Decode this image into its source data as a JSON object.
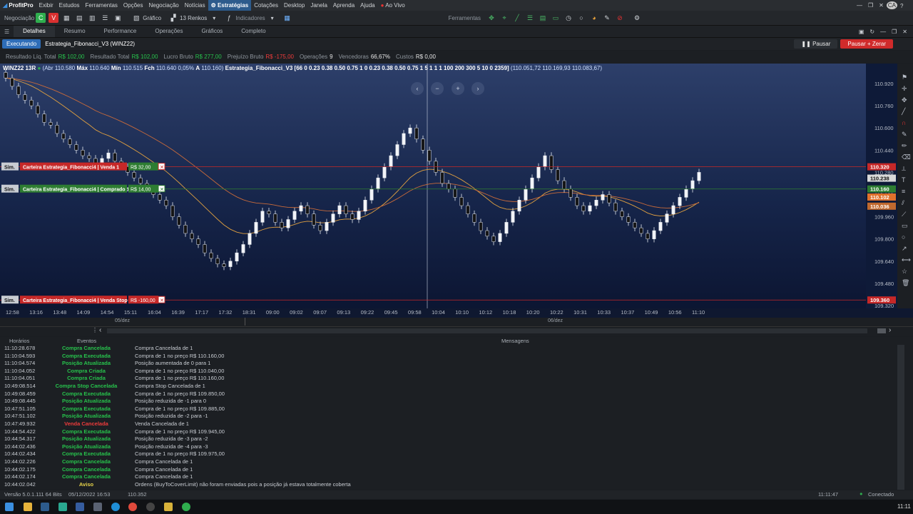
{
  "menubar": {
    "app_name": "ProfitPro",
    "items": [
      "Exibir",
      "Estudos",
      "Ferramentas",
      "Opções",
      "Negociação",
      "Notícias",
      "Estratégias",
      "Cotações",
      "Desktop",
      "Janela",
      "Aprenda",
      "Ajuda"
    ],
    "live_label": "Ao Vivo"
  },
  "toolbar": {
    "negociacao_label": "Negociação",
    "grafico_label": "Gráfico",
    "renkos_label": "13 Renkos",
    "indicadores_label": "Indicadores",
    "ferramentas_label": "Ferramentas"
  },
  "tabs": [
    "Detalhes",
    "Resumo",
    "Performance",
    "Operações",
    "Gráficos",
    "Completo"
  ],
  "strategy": {
    "status": "Executando",
    "name": "Estrategia_Fibonacci_V3 (WINZ22)",
    "pause_label": "Pausar",
    "pause_zero_label": "Pausar + Zerar"
  },
  "stats": [
    {
      "label": "Resultado Líq. Total",
      "value": "R$ 102,00",
      "color": "green"
    },
    {
      "label": "Resultado Total",
      "value": "R$ 102,00",
      "color": "green"
    },
    {
      "label": "Lucro Bruto",
      "value": "R$ 277,00",
      "color": "green"
    },
    {
      "label": "Prejuízo Bruto",
      "value": "R$ -175,00",
      "color": "red"
    },
    {
      "label": "Operações",
      "value": "9",
      "color": "white"
    },
    {
      "label": "Vencedoras",
      "value": "66,67%",
      "color": "white"
    },
    {
      "label": "Custos",
      "value": "R$ 0,00",
      "color": "white"
    }
  ],
  "chart_info": {
    "symbol": "WINZ22 13R",
    "abr_label": "(Abr",
    "abr": "110.580",
    "max_label": "Máx",
    "max": "110.640",
    "min_label": "Mín",
    "min": "110.515",
    "fch_label": "Fch",
    "fch": "110.640",
    "var": "0,05%",
    "a_label": "A",
    "a": "110.160)",
    "study": "Estrategia_Fibonacci_V3 [66 0 0.23 0.38 0.50 0.75 1 0 0.23 0.38 0.50 0.75 1 5 1 1 1 100 200 300 5 10 0 2359]",
    "study_values": "(110.051,72 110.169,93 110.083,67)"
  },
  "chart_data": {
    "type": "candlestick",
    "price_ticks": [
      "110.920",
      "110.760",
      "110.600",
      "110.440",
      "110.280",
      "110.120",
      "109.960",
      "109.800",
      "109.640",
      "109.480",
      "109.320"
    ],
    "price_tick_values": [
      110920,
      110760,
      110600,
      110440,
      110280,
      110120,
      109960,
      109800,
      109640,
      109480,
      109320
    ],
    "time_ticks": [
      "12:58",
      "13:16",
      "13:48",
      "14:09",
      "14:54",
      "15:11",
      "16:04",
      "16:39",
      "17:17",
      "17:32",
      "18:31",
      "09:00",
      "09:02",
      "09:07",
      "09:13",
      "09:22",
      "09:45",
      "09:58",
      "10:04",
      "10:10",
      "10:12",
      "10:18",
      "10:20",
      "10:22",
      "10:31",
      "10:33",
      "10:37",
      "10:49",
      "10:56",
      "11:10"
    ],
    "dates": [
      "05/dez",
      "06/dez"
    ],
    "price_labels": [
      {
        "text": "110.320",
        "value": 110320,
        "bg": "#c62828"
      },
      {
        "text": "110.238",
        "value": 110238,
        "bg": "#d9d9d9"
      },
      {
        "text": "110.160",
        "value": 110160,
        "bg": "#2e7d32"
      },
      {
        "text": "110.102",
        "value": 110102,
        "bg": "#e0712c"
      },
      {
        "text": "110.036",
        "value": 110036,
        "bg": "#c0692e"
      },
      {
        "text": "109.360",
        "value": 109360,
        "bg": "#c62828"
      }
    ],
    "order_lines": [
      {
        "tag": "Sim.",
        "desc": "Carteira Estrategia_Fibonacci4 | Venda 1",
        "value_label": "R$ 32,00",
        "value": 110320,
        "color": "#c62828",
        "badge": "#2e7d32"
      },
      {
        "tag": "Sim.",
        "desc": "Carteira Estrategia_Fibonacci4 | Comprado 1",
        "value_label": "R$ 14,00",
        "value": 110160,
        "color": "#2e7d32",
        "badge": "#2e7d32"
      },
      {
        "tag": "Sim.",
        "desc": "Carteira Estrategia_Fibonacci4 | Venda Stop 1",
        "value_label": "R$ -160,00",
        "value": 109360,
        "color": "#c62828",
        "badge": "#c62828"
      }
    ],
    "closes": [
      110960,
      110900,
      110840,
      110800,
      110760,
      110700,
      110640,
      110620,
      110560,
      110520,
      110480,
      110440,
      110400,
      110380,
      110320,
      110380,
      110420,
      110360,
      110320,
      110280,
      110240,
      110200,
      110160,
      110120,
      110080,
      110040,
      109960,
      109900,
      109840,
      109800,
      109760,
      109700,
      109660,
      109620,
      109600,
      109640,
      109700,
      109760,
      109840,
      109920,
      110000,
      109980,
      109920,
      109880,
      109940,
      110000,
      110040,
      109980,
      109900,
      109860,
      109920,
      109980,
      110040,
      109980,
      109940,
      110000,
      110080,
      110160,
      110240,
      110320,
      110400,
      110480,
      110560,
      110600,
      110520,
      110440,
      110360,
      110280,
      110200,
      110160,
      110100,
      110040,
      109980,
      109920,
      109860,
      109820,
      109780,
      109840,
      109920,
      110000,
      110080,
      110160,
      110240,
      110320,
      110400,
      110300,
      110220,
      110160,
      110100,
      110040,
      110000,
      110040,
      110080,
      110120,
      110060,
      110000,
      109960,
      109920,
      109880,
      109840,
      109800,
      109860,
      109920,
      109980,
      110040,
      110100,
      110160,
      110220,
      110280
    ]
  },
  "log": {
    "headers": {
      "time": "Horários",
      "event": "Eventos",
      "msg": "Mensagens"
    },
    "rows": [
      {
        "time": "11:10:28.678",
        "event": "Compra Cancelada",
        "color": "green",
        "msg": "Compra Cancelada de 1"
      },
      {
        "time": "11:10:04.593",
        "event": "Compra Executada",
        "color": "green",
        "msg": "Compra de 1 no preço R$ 110.160,00"
      },
      {
        "time": "11:10:04.574",
        "event": "Posição Atualizada",
        "color": "green",
        "msg": "Posição aumentada de 0 para 1"
      },
      {
        "time": "11:10:04.052",
        "event": "Compra Criada",
        "color": "green",
        "msg": "Compra de 1 no preço R$ 110.040,00"
      },
      {
        "time": "11:10:04.051",
        "event": "Compra Criada",
        "color": "green",
        "msg": "Compra de 1 no preço R$ 110.160,00"
      },
      {
        "time": "10:49:08.514",
        "event": "Compra Stop Cancelada",
        "color": "green",
        "msg": "Compra Stop Cancelada de 1"
      },
      {
        "time": "10:49:08.459",
        "event": "Compra Executada",
        "color": "green",
        "msg": "Compra de 1 no preço R$ 109.850,00"
      },
      {
        "time": "10:49:08.445",
        "event": "Posição Atualizada",
        "color": "green",
        "msg": "Posição reduzida de -1 para 0"
      },
      {
        "time": "10:47:51.105",
        "event": "Compra Executada",
        "color": "green",
        "msg": "Compra de 1 no preço R$ 109.885,00"
      },
      {
        "time": "10:47:51.102",
        "event": "Posição Atualizada",
        "color": "green",
        "msg": "Posição reduzida de -2 para -1"
      },
      {
        "time": "10:47:49.932",
        "event": "Venda Cancelada",
        "color": "red",
        "msg": "Venda Cancelada de 1"
      },
      {
        "time": "10:44:54.422",
        "event": "Compra Executada",
        "color": "green",
        "msg": "Compra de 1 no preço R$ 109.945,00"
      },
      {
        "time": "10:44:54.317",
        "event": "Posição Atualizada",
        "color": "green",
        "msg": "Posição reduzida de -3 para -2"
      },
      {
        "time": "10:44:02.436",
        "event": "Posição Atualizada",
        "color": "green",
        "msg": "Posição reduzida de -4 para -3"
      },
      {
        "time": "10:44:02.434",
        "event": "Compra Executada",
        "color": "green",
        "msg": "Compra de 1 no preço R$ 109.975,00"
      },
      {
        "time": "10:44:02.226",
        "event": "Compra Cancelada",
        "color": "green",
        "msg": "Compra Cancelada de 1"
      },
      {
        "time": "10:44:02.175",
        "event": "Compra Cancelada",
        "color": "green",
        "msg": "Compra Cancelada de 1"
      },
      {
        "time": "10:44:02.174",
        "event": "Compra Cancelada",
        "color": "green",
        "msg": "Compra Cancelada de 1"
      },
      {
        "time": "10:44:02.042",
        "event": "Aviso",
        "color": "yellow",
        "msg": "Ordens (BuyToCoverLimit) não foram enviadas pois a posição já estava totalmente coberta"
      }
    ]
  },
  "status": {
    "version": "Versão 5.0.1.111 64 Bits",
    "datetime": "05/12/2022 16:53",
    "value": "110.352",
    "clock": "11:11:47",
    "connection": "Conectado"
  },
  "taskbar": {
    "clock": "11:11"
  }
}
